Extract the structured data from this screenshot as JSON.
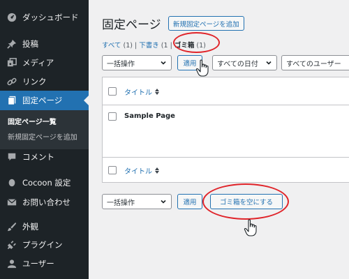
{
  "sidebar": {
    "items": [
      {
        "label": "ダッシュボード",
        "icon": "dashboard-icon"
      },
      {
        "label": "投稿",
        "icon": "pin-icon"
      },
      {
        "label": "メディア",
        "icon": "media-icon"
      },
      {
        "label": "リンク",
        "icon": "link-icon"
      },
      {
        "label": "固定ページ",
        "icon": "page-icon"
      },
      {
        "label": "コメント",
        "icon": "comment-icon"
      },
      {
        "label": "Cocoon 設定",
        "icon": "cocoon-icon"
      },
      {
        "label": "お問い合わせ",
        "icon": "mail-icon"
      },
      {
        "label": "外観",
        "icon": "brush-icon"
      },
      {
        "label": "プラグイン",
        "icon": "plugin-icon"
      },
      {
        "label": "ユーザー",
        "icon": "user-icon"
      }
    ],
    "submenu": [
      "固定ページ一覧",
      "新規固定ページを追加"
    ]
  },
  "header": {
    "title": "固定ページ",
    "add_new": "新規固定ページを追加"
  },
  "status_links": {
    "all": "すべて",
    "all_count": "(1)",
    "drafts": "下書き",
    "drafts_count": "(1",
    "trash": "ゴミ箱",
    "trash_count": "(1)",
    "sep": "|"
  },
  "top_controls": {
    "bulk_action": "一括操作",
    "apply": "適用",
    "all_dates": "すべての日付",
    "all_users": "すべてのユーザー"
  },
  "table": {
    "column_title": "タイトル",
    "rows": [
      {
        "title": "Sample Page"
      }
    ]
  },
  "bottom_controls": {
    "bulk_action": "一括操作",
    "apply": "適用",
    "empty_trash": "ゴミ箱を空にする"
  },
  "colors": {
    "sidebar_bg": "#1d2327",
    "accent": "#2271b1",
    "highlight": "#e0242a"
  }
}
